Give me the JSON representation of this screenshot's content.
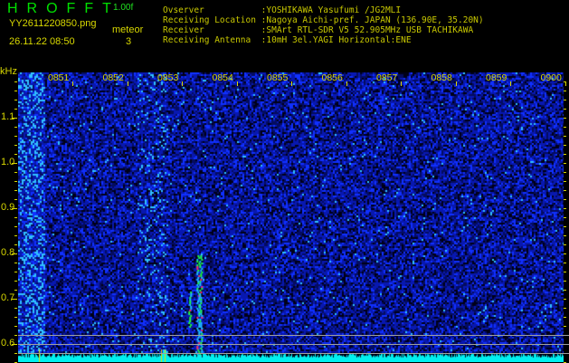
{
  "header": {
    "title": "HROFFT",
    "version": "1.00f",
    "filename": "YY2611220850.png",
    "datetime": "26.11.22 08:50",
    "meteor_label": "meteor",
    "meteor_count": "3"
  },
  "info": [
    "Ovserver           :YOSHIKAWA Yasufumi /JG2MLI",
    "Receiving Location :Nagoya Aichi-pref. JAPAN (136.90E, 35.20N)",
    "Receiver           :SMArt RTL-SDR V5 52.905MHz USB TACHIKAWA",
    "Receiving Antenna  :10mH 3el.YAGI Horizontal:ENE"
  ],
  "chart_data": {
    "type": "heatmap",
    "title": "HROFFT spectrogram",
    "ylabel": "kHz",
    "ylim": [
      0.56,
      1.2
    ],
    "x_ticks": [
      "0851",
      "0852",
      "0853",
      "0854",
      "0855",
      "0856",
      "0857",
      "0858",
      "0859",
      "0900"
    ],
    "y_ticks": [
      "1.1",
      "1.0",
      "0.9",
      "0.8",
      "0.7",
      "0.6"
    ],
    "y_tick_values": [
      1.1,
      1.0,
      0.9,
      0.8,
      0.7,
      0.6
    ],
    "xlim_minutes": [
      0,
      10
    ],
    "meteors": [
      {
        "time_min": 2.45,
        "freq_khz": [
          0.64,
          0.72
        ]
      },
      {
        "time_min": 2.6,
        "freq_khz": [
          0.56,
          0.8
        ]
      },
      {
        "time_min": 2.65,
        "freq_khz": [
          0.58,
          0.8
        ]
      }
    ],
    "colors": {
      "background": "#000030",
      "noise": "#0010c0",
      "hot": "#00ffff",
      "axis": "#d8d800",
      "header": "#00e000"
    }
  }
}
